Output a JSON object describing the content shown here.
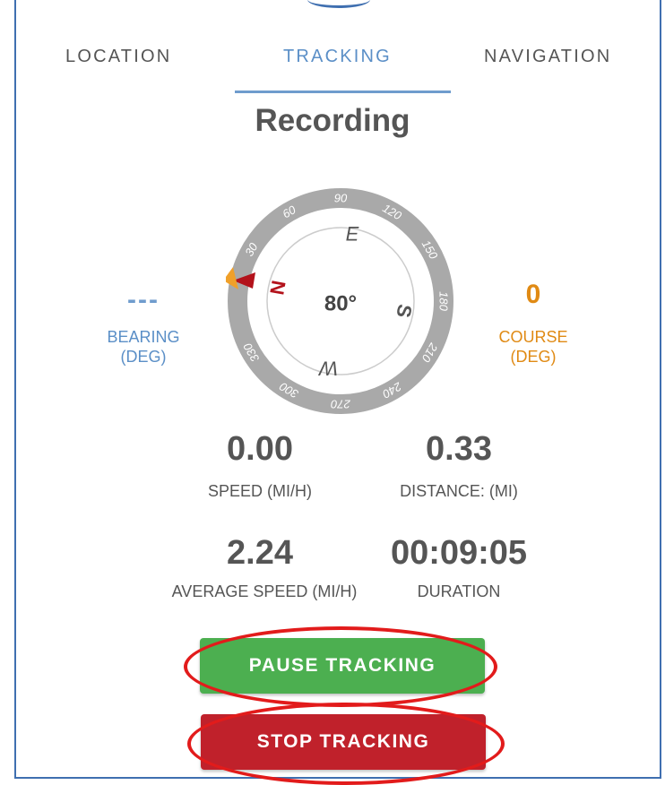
{
  "tabs": [
    {
      "label": "LOCATION",
      "active": false
    },
    {
      "label": "TRACKING",
      "active": true
    },
    {
      "label": "NAVIGATION",
      "active": false
    }
  ],
  "status_title": "Recording",
  "compass": {
    "heading": "80°",
    "cardinals": {
      "north": "N",
      "east": "E",
      "south": "S",
      "west": "W"
    },
    "tick_labels": [
      "30",
      "60",
      "90",
      "120",
      "150",
      "180",
      "210",
      "240",
      "270",
      "300",
      "330"
    ],
    "pointer_color": "#b3121b",
    "marker_color": "#f0a02a"
  },
  "bearing": {
    "value": "---",
    "label_line1": "BEARING",
    "label_line2": "(DEG)",
    "color": "#6f9ccd"
  },
  "course": {
    "value": "0",
    "label_line1": "COURSE",
    "label_line2": "(DEG)",
    "color": "#e08a14"
  },
  "stats": {
    "speed": {
      "value": "0.00",
      "label": "SPEED (MI/H)"
    },
    "distance": {
      "value": "0.33",
      "label": "DISTANCE: (MI)"
    },
    "average_speed": {
      "value": "2.24",
      "label": "AVERAGE SPEED (MI/H)"
    },
    "duration": {
      "value": "00:09:05",
      "label": "DURATION"
    }
  },
  "buttons": {
    "pause": {
      "label": "PAUSE TRACKING",
      "color": "#4caf50"
    },
    "stop": {
      "label": "STOP TRACKING",
      "color": "#c0212b"
    }
  },
  "annotation_color": "#e21b1b"
}
